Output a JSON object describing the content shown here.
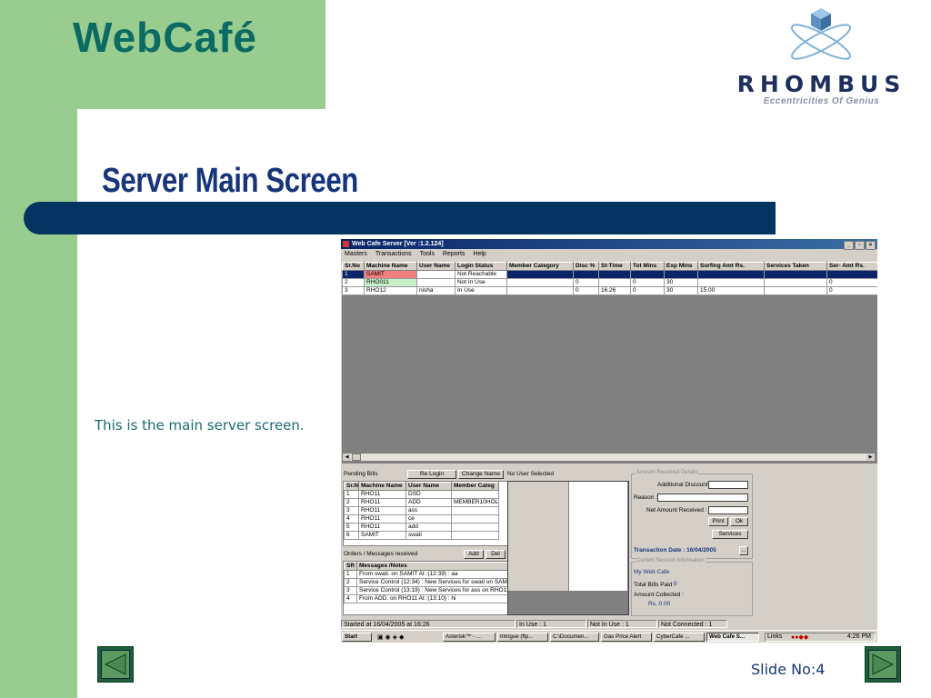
{
  "brand": "WebCafé",
  "logo": {
    "name": "RHOMBUS",
    "tagline": "Eccentricities Of Genius"
  },
  "title": "Server Main Screen",
  "caption": "This is the main server screen.",
  "slide_no": "Slide No:4",
  "screenshot": {
    "window_title": "Web Cafe Server [Ver :1.2.124]",
    "window_buttons": [
      "_",
      "▫",
      "×"
    ],
    "menu": [
      "Masters",
      "Transactions",
      "Tools",
      "Reports",
      "Help"
    ],
    "grid": {
      "headers": [
        "Sr.No",
        "Machine Name",
        "User Name",
        "Login Status",
        "Member Category",
        "Disc %",
        "St-Time",
        "Tot Mins",
        "Exp Mins",
        "Surfing Amt Rs.",
        "Services Taken",
        "Ser- Amt Rs."
      ],
      "rows": [
        [
          "1",
          "SAMIT",
          "",
          "Not Reachable",
          "",
          "",
          "",
          "",
          "",
          "",
          "",
          ""
        ],
        [
          "2",
          "RHO011",
          "",
          "Not In Use",
          "",
          "0",
          "",
          "0",
          "30",
          "",
          "",
          "0"
        ],
        [
          "3",
          "RHO12",
          "nisha",
          "In Use",
          "",
          "0",
          "16.26",
          "0",
          "30",
          "15.00",
          "",
          "0"
        ]
      ]
    },
    "pending": {
      "label": "Pending Bills",
      "relogin": "Re Login",
      "change_name": "Change Name",
      "no_user": "No User Selected",
      "headers": [
        "Sr.N",
        "Machine Name",
        "User Name",
        "Member Categ"
      ],
      "rows": [
        [
          "1",
          "RHO11",
          "DSD",
          ""
        ],
        [
          "2",
          "RHO11",
          "ADD",
          "MEMBER10HOL"
        ],
        [
          "3",
          "RHO11",
          "ass",
          ""
        ],
        [
          "4",
          "RHO11",
          "ce",
          ""
        ],
        [
          "5",
          "RHO11",
          "add",
          ""
        ],
        [
          "6",
          "SAMIT",
          "swati",
          ""
        ]
      ]
    },
    "orders": {
      "label": "Orders / Messages received",
      "add": "Add",
      "del": "Del",
      "headers": [
        "SR",
        "Messages /Notes"
      ],
      "rows": [
        [
          "1",
          "From swati. on SAMIT At :(12:39) : aa"
        ],
        [
          "2",
          "Service Control (12:34) : New Services for swati on SAMIT"
        ],
        [
          "3",
          "Service Control (13:19) : New Services for ass on RHO11"
        ],
        [
          "4",
          "From ADD. on RHO11 At :(13:10) : hi"
        ]
      ]
    },
    "amount": {
      "legend": "Amount Received Details",
      "additional_discount": "Additional Discount :",
      "reason": "Reason :",
      "net_amount": "Net Amount Received :",
      "print": "Print",
      "ok": "Ok",
      "services": "Services",
      "transaction_date": "Transaction Date : 16/04/2005",
      "ellipsis": "..."
    },
    "session": {
      "legend": "Current Session Information",
      "cafe": "My Web Cafe",
      "bills_paid": "Total Bills Paid :",
      "bills_paid_value": "0",
      "amount_collected": "Amount Collected :",
      "amount_value": "Rs. 0.00"
    },
    "status": [
      "Started at 16/04/2005 at 16:26",
      "In Use : 1",
      "Not In Use : 1",
      "Not Connected : 1"
    ],
    "taskbar": {
      "start": "Start",
      "tasks": [
        "Asterisk™ - ...",
        "Intrigue (ftp...",
        "C:\\Documen...",
        "Gas Price Alert",
        "CyberCafe ...",
        "Web Cafe S..."
      ],
      "links": "Links",
      "clock": "4:26 PM"
    }
  }
}
